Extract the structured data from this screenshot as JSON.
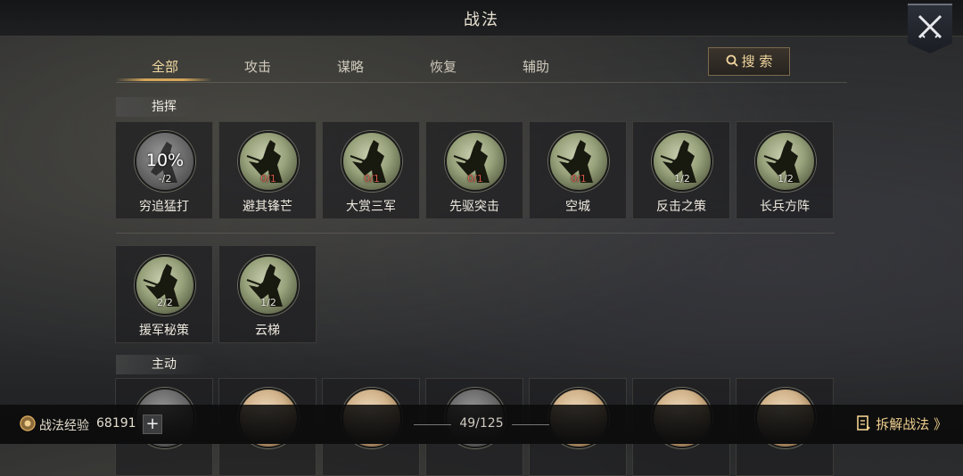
{
  "header": {
    "title": "战法"
  },
  "tabs": [
    {
      "label": "全部",
      "active": true
    },
    {
      "label": "攻击"
    },
    {
      "label": "谋略"
    },
    {
      "label": "恢复"
    },
    {
      "label": "辅助"
    }
  ],
  "search": {
    "label": "搜 索",
    "icon": "search-icon"
  },
  "sections": {
    "command": {
      "label": "指挥"
    },
    "active": {
      "label": "主动"
    }
  },
  "command_row1": [
    {
      "name": "穷追猛打",
      "level": "-/2",
      "progress": "10%",
      "state": "grey"
    },
    {
      "name": "避其锋芒",
      "level": "0/1",
      "state": "red"
    },
    {
      "name": "大赏三军",
      "level": "0/1",
      "state": "red"
    },
    {
      "name": "先驱突击",
      "level": "0/1",
      "state": "red"
    },
    {
      "name": "空城",
      "level": "0/1",
      "state": "red"
    },
    {
      "name": "反击之策",
      "level": "1/2",
      "state": "normal"
    },
    {
      "name": "长兵方阵",
      "level": "1/2",
      "state": "normal"
    }
  ],
  "command_row2": [
    {
      "name": "援军秘策",
      "level": "2/2",
      "state": "normal"
    },
    {
      "name": "云梯",
      "level": "1/2",
      "state": "normal"
    }
  ],
  "footer": {
    "exp_label": "战法经验",
    "exp_value": "68191",
    "plus_label": "+",
    "page": "49/125",
    "disassemble_label": "拆解战法 》"
  },
  "colors": {
    "accent": "#d4a55a",
    "red_level": "#d35a4a",
    "gold_text": "#f0cf8e"
  }
}
